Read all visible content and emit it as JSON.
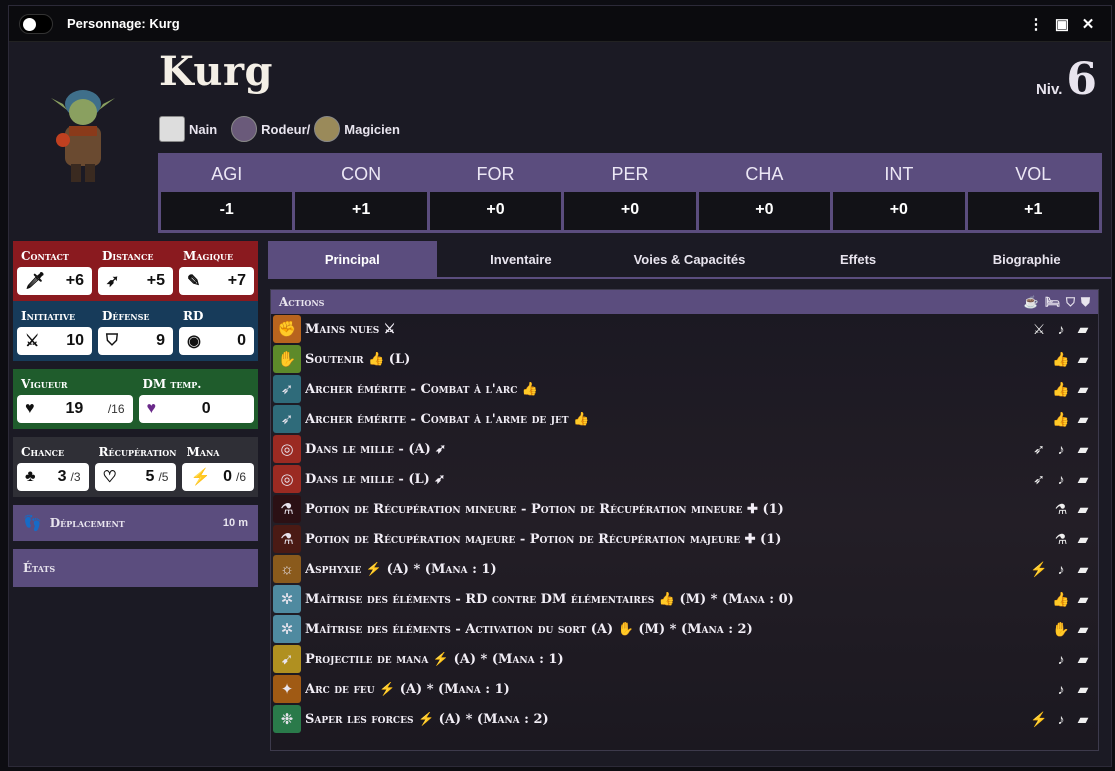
{
  "window": {
    "title": "Personnage: Kurg"
  },
  "character": {
    "name": "Kurg",
    "level_label": "Niv.",
    "level": "6",
    "classes": [
      {
        "label": "Nain"
      },
      {
        "label": "Rodeur/"
      },
      {
        "label": "Magicien"
      }
    ]
  },
  "abilities": [
    {
      "name": "AGI",
      "value": "-1"
    },
    {
      "name": "CON",
      "value": "+1"
    },
    {
      "name": "FOR",
      "value": "+0"
    },
    {
      "name": "PER",
      "value": "+0"
    },
    {
      "name": "CHA",
      "value": "+0"
    },
    {
      "name": "INT",
      "value": "+0"
    },
    {
      "name": "VOL",
      "value": "+1"
    }
  ],
  "attacks": {
    "contact": {
      "label": "Contact",
      "value": "+6"
    },
    "distance": {
      "label": "Distance",
      "value": "+5"
    },
    "magique": {
      "label": "Magique",
      "value": "+7"
    }
  },
  "defense": {
    "initiative": {
      "label": "Initiative",
      "value": "10"
    },
    "defense": {
      "label": "Défense",
      "value": "9"
    },
    "rd": {
      "label": "RD",
      "value": "0"
    }
  },
  "health": {
    "vigueur": {
      "label": "Vigueur",
      "value": "19",
      "max": "/16"
    },
    "dm_temp": {
      "label": "DM temp.",
      "value": "0"
    }
  },
  "resources": {
    "chance": {
      "label": "Chance",
      "value": "3",
      "max": "/3"
    },
    "recuperation": {
      "label": "Récupération",
      "value": "5",
      "max": "/5"
    },
    "mana": {
      "label": "Mana",
      "value": "0",
      "max": "/6"
    }
  },
  "deplacement": {
    "label": "Déplacement",
    "value": "10 m"
  },
  "etats": {
    "label": "États"
  },
  "tabs": [
    "Principal",
    "Inventaire",
    "Voies & Capacités",
    "Effets",
    "Biographie"
  ],
  "actions": {
    "header": "Actions",
    "rows": [
      {
        "label": "Mains nues ⚔",
        "icon_bg": "#b8641e",
        "icon": "✊",
        "btns": [
          "⚔",
          "♪",
          "▰"
        ]
      },
      {
        "label": "Soutenir 👍 (L)",
        "icon_bg": "#5d8a2a",
        "icon": "✋",
        "btns": [
          "👍",
          "▰"
        ]
      },
      {
        "label": "Archer émérite - Combat à l'arc 👍",
        "icon_bg": "#2f6b7a",
        "icon": "➶",
        "btns": [
          "👍d",
          "▰"
        ]
      },
      {
        "label": "Archer émérite - Combat à l'arme de jet 👍",
        "icon_bg": "#2f6b7a",
        "icon": "➶",
        "btns": [
          "👍d",
          "▰"
        ]
      },
      {
        "label": "Dans le mille - (A) ➶",
        "icon_bg": "#9b2a22",
        "icon": "◎",
        "btns": [
          "➶",
          "♪",
          "▰"
        ]
      },
      {
        "label": "Dans le mille - (L) ➶",
        "icon_bg": "#9b2a22",
        "icon": "◎",
        "btns": [
          "➶",
          "♪",
          "▰"
        ]
      },
      {
        "label": "Potion de Récupération mineure - Potion de Récupération mineure ✚ (1)",
        "icon_bg": "#2b1014",
        "icon": "⚗",
        "btns": [
          "⚗",
          "▰"
        ]
      },
      {
        "label": "Potion de Récupération majeure - Potion de Récupération majeure ✚ (1)",
        "icon_bg": "#4a1a14",
        "icon": "⚗",
        "btns": [
          "⚗",
          "▰"
        ]
      },
      {
        "label": "Asphyxie ⚡ (A) * (Mana : 1)",
        "icon_bg": "#8a5a1c",
        "icon": "☼",
        "btns": [
          "⚡",
          "♪",
          "▰"
        ]
      },
      {
        "label": "Maîtrise des éléments - RD contre DM élémentaires 👍 (M) * (Mana : 0)",
        "icon_bg": "#4f8aa0",
        "icon": "✲",
        "btns": [
          "👍d",
          "▰"
        ]
      },
      {
        "label": "Maîtrise des éléments - Activation du sort (A) ✋ (M) * (Mana : 2)",
        "icon_bg": "#4f8aa0",
        "icon": "✲",
        "btns": [
          "✋",
          "▰"
        ]
      },
      {
        "label": "Projectile de mana ⚡ (A) * (Mana : 1)",
        "icon_bg": "#b09020",
        "icon": "➹",
        "btns": [
          "♪",
          "▰"
        ]
      },
      {
        "label": "Arc de feu ⚡ (A) * (Mana : 1)",
        "icon_bg": "#a05a14",
        "icon": "✦",
        "btns": [
          "♪",
          "▰"
        ]
      },
      {
        "label": "Saper les forces ⚡ (A) * (Mana : 2)",
        "icon_bg": "#2a7a4a",
        "icon": "❉",
        "btns": [
          "⚡",
          "♪",
          "▰"
        ]
      }
    ]
  },
  "colors": {
    "accent": "#5b4d7e",
    "contact": "#8a1a1f",
    "defense": "#173b5a",
    "vigueur": "#1f5c2c"
  }
}
